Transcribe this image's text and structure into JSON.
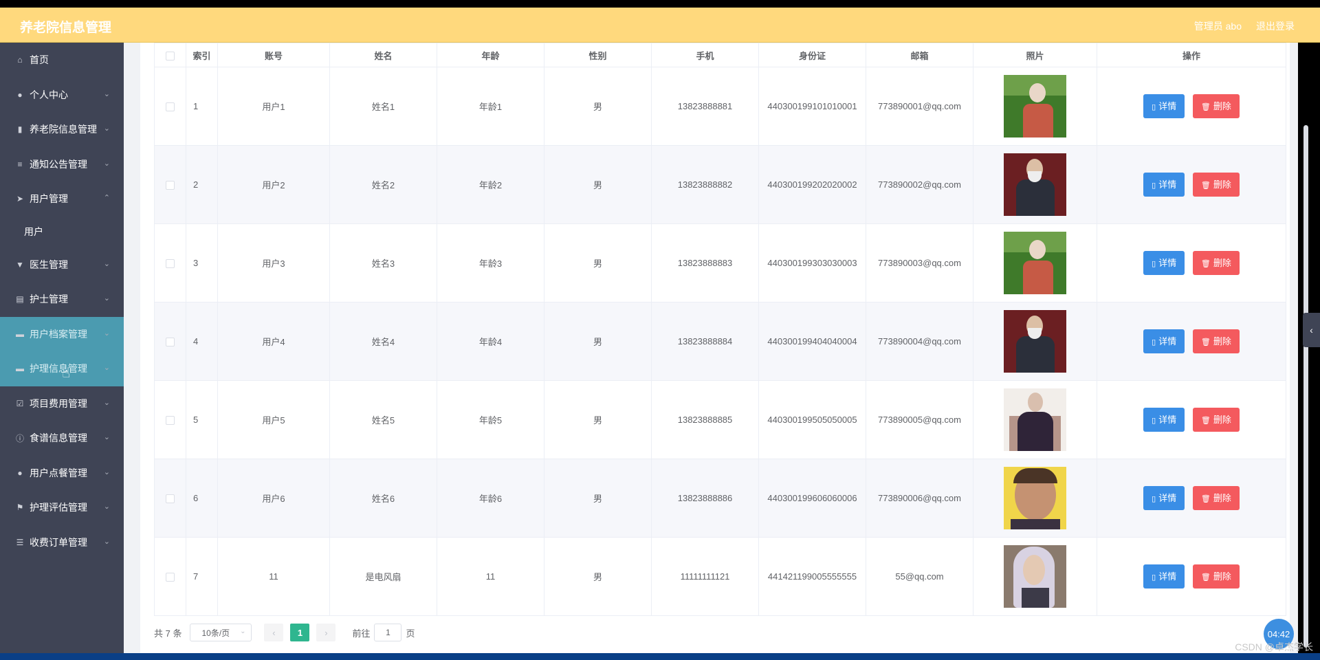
{
  "header": {
    "brand": "养老院信息管理",
    "admin": "管理员 abo",
    "logout": "退出登录"
  },
  "sidebar": {
    "items": [
      {
        "label": "首页",
        "icon": "home-icon"
      },
      {
        "label": "个人中心",
        "icon": "user-icon"
      },
      {
        "label": "养老院信息管理",
        "icon": "chart-icon"
      },
      {
        "label": "通知公告管理",
        "icon": "sliders-icon"
      },
      {
        "label": "用户管理",
        "icon": "send-icon"
      },
      {
        "label": "医生管理",
        "icon": "stamp-icon"
      },
      {
        "label": "护士管理",
        "icon": "clipboard-icon"
      },
      {
        "label": "用户档案管理",
        "icon": "folder-icon"
      },
      {
        "label": "护理信息管理",
        "icon": "folder-icon"
      },
      {
        "label": "项目费用管理",
        "icon": "checkbox-icon"
      },
      {
        "label": "食谱信息管理",
        "icon": "info-icon"
      },
      {
        "label": "用户点餐管理",
        "icon": "user-icon"
      },
      {
        "label": "护理评估管理",
        "icon": "flag-icon"
      },
      {
        "label": "收费订单管理",
        "icon": "list-icon"
      }
    ],
    "subitem": "用户"
  },
  "table": {
    "headers": [
      "索引",
      "账号",
      "姓名",
      "年龄",
      "性别",
      "手机",
      "身份证",
      "邮箱",
      "照片",
      "操作"
    ],
    "rows": [
      {
        "index": "1",
        "account": "用户1",
        "name": "姓名1",
        "age": "年龄1",
        "gender": "男",
        "phone": "13823888881",
        "id_card": "440300199101010001",
        "email": "773890001@qq.com"
      },
      {
        "index": "2",
        "account": "用户2",
        "name": "姓名2",
        "age": "年龄2",
        "gender": "男",
        "phone": "13823888882",
        "id_card": "440300199202020002",
        "email": "773890002@qq.com"
      },
      {
        "index": "3",
        "account": "用户3",
        "name": "姓名3",
        "age": "年龄3",
        "gender": "男",
        "phone": "13823888883",
        "id_card": "440300199303030003",
        "email": "773890003@qq.com"
      },
      {
        "index": "4",
        "account": "用户4",
        "name": "姓名4",
        "age": "年龄4",
        "gender": "男",
        "phone": "13823888884",
        "id_card": "440300199404040004",
        "email": "773890004@qq.com"
      },
      {
        "index": "5",
        "account": "用户5",
        "name": "姓名5",
        "age": "年龄5",
        "gender": "男",
        "phone": "13823888885",
        "id_card": "440300199505050005",
        "email": "773890005@qq.com"
      },
      {
        "index": "6",
        "account": "用户6",
        "name": "姓名6",
        "age": "年龄6",
        "gender": "男",
        "phone": "13823888886",
        "id_card": "440300199606060006",
        "email": "773890006@qq.com"
      },
      {
        "index": "7",
        "account": "11",
        "name": "是电风扇",
        "age": "11",
        "gender": "男",
        "phone": "11111111121",
        "id_card": "441421199005555555",
        "email": "55@qq.com"
      }
    ],
    "detail_label": "详情",
    "delete_label": "删除"
  },
  "pager": {
    "total": "共 7 条",
    "page_size": "10条/页",
    "current_page": "1",
    "goto_label": "前往",
    "goto_value": "1",
    "page_suffix": "页"
  },
  "overlay": {
    "timer": "04:42",
    "watermark": "CSDN @卓杰学长"
  },
  "colors": {
    "header_bg": "#ffd97d",
    "sidebar_bg": "#3f4455",
    "sidebar_highlight": "#4b9bb0",
    "detail_button": "#3a8ee6",
    "delete_button": "#f45a5e",
    "pager_active": "#2fb68f"
  }
}
